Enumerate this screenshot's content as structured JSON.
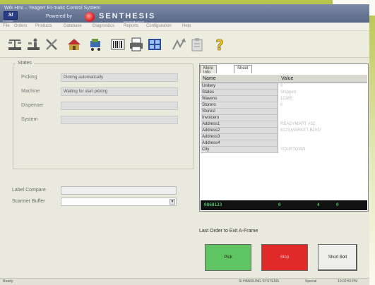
{
  "window": {
    "title": "Wrk Hmi – Yeagerr Et-matic Control System",
    "logo_text": "SI",
    "logo_caption": "SYSTEMS",
    "powered_by": "Powered by",
    "brand_name": "SENTHESIS",
    "brand_sub": "SOFTWARE GROUP"
  },
  "menu": [
    "File",
    "Orders",
    "Products",
    "Database",
    "Diagnostics",
    "Reports",
    "Configuration",
    "Help"
  ],
  "toolbar": [
    {
      "icon": "scale-icon"
    },
    {
      "icon": "person-scale-icon"
    },
    {
      "icon": "tools-icon"
    },
    {
      "icon": "house-icon"
    },
    {
      "icon": "cart-icon"
    },
    {
      "icon": "barcode-icon"
    },
    {
      "icon": "printer-icon"
    },
    {
      "icon": "grid-icon"
    },
    {
      "icon": "arrow-tool-icon"
    },
    {
      "icon": "clipboard-icon"
    },
    {
      "icon": "help-icon"
    }
  ],
  "status": {
    "legend": "States",
    "rows": [
      {
        "label": "Picking",
        "value": "Picking automatically"
      },
      {
        "label": "Machine",
        "value": "Waiting for start picking"
      },
      {
        "label": "Dispenser",
        "value": ""
      },
      {
        "label": "System",
        "value": ""
      }
    ]
  },
  "bottom_fields": {
    "label_compare": "Label Compare",
    "scanner_buffer": "Scanner Buffer"
  },
  "tabs": [
    "More Info",
    "Sheet"
  ],
  "grid": {
    "headers": [
      "Name",
      "Value"
    ],
    "rows": [
      {
        "name": "Unitery",
        "value": "0"
      },
      {
        "name": "States",
        "value": "Shipped"
      },
      {
        "name": "Wavens",
        "value": "12385"
      },
      {
        "name": "Storero",
        "value": "0"
      },
      {
        "name": "Storesl",
        "value": ""
      },
      {
        "name": "Invoicero",
        "value": ""
      },
      {
        "name": "Address1",
        "value": "READYMART #32"
      },
      {
        "name": "Address2",
        "value": "8123 MARKET BLVD"
      },
      {
        "name": "Address3",
        "value": ""
      },
      {
        "name": "Address4",
        "value": ""
      },
      {
        "name": "City",
        "value": "YOURTOWN"
      }
    ]
  },
  "blackbar": [
    "0868123",
    "0",
    "4",
    "0"
  ],
  "last_order": "Last Order to Exit A-Frame",
  "buttons": {
    "pick": "Pick",
    "stop": "Stop",
    "short": "Short Bolt"
  },
  "statusbar": {
    "left": "Ready",
    "system": "SI HANDLING SYSTEMS",
    "mode": "Special",
    "time": "10:02:50 PM"
  },
  "colors": {
    "pick": "#5fc462",
    "stop": "#e02a2a",
    "titlebar": "#6b7898"
  }
}
